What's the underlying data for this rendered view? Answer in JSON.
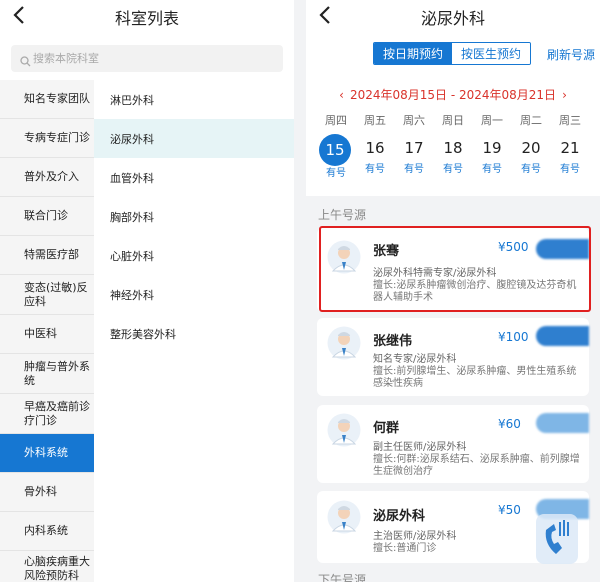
{
  "left": {
    "title": "科室列表",
    "search_placeholder": "搜索本院科室",
    "categories": [
      "知名专家团队",
      "专病专症门诊",
      "普外及介入",
      "联合门诊",
      "特需医疗部",
      "变态(过敏)反应科",
      "中医科",
      "肿瘤与普外系统",
      "早癌及癌前诊疗门诊",
      "外科系统",
      "骨外科",
      "内科系统",
      "心脑疾病重大风险预防科"
    ],
    "active_category_index": 9,
    "subdepartments": [
      "淋巴外科",
      "泌尿外科",
      "血管外科",
      "胸部外科",
      "心脏外科",
      "神经外科",
      "整形美容外科"
    ],
    "active_sub_index": 1
  },
  "right": {
    "title": "泌尿外科",
    "tabs": [
      "按日期预约",
      "按医生预约"
    ],
    "active_tab_index": 0,
    "refresh_label": "刷新号源",
    "date_range": "2024年08月15日 - 2024年08月21日",
    "days": [
      {
        "weekday": "周四",
        "date": "15",
        "status": "有号"
      },
      {
        "weekday": "周五",
        "date": "16",
        "status": "有号"
      },
      {
        "weekday": "周六",
        "date": "17",
        "status": "有号"
      },
      {
        "weekday": "周日",
        "date": "18",
        "status": "有号"
      },
      {
        "weekday": "周一",
        "date": "19",
        "status": "有号"
      },
      {
        "weekday": "周二",
        "date": "20",
        "status": "有号"
      },
      {
        "weekday": "周三",
        "date": "21",
        "status": "有号"
      }
    ],
    "selected_day_index": 0,
    "morning_label": "上午号源",
    "afternoon_label": "下午号源",
    "doctors": [
      {
        "name": "张骞",
        "price": "¥500",
        "title": "泌尿外科特需专家/泌尿外科",
        "skill": "擅长:泌尿系肿瘤微创治疗、腹腔镜及达芬奇机器人辅助手术"
      },
      {
        "name": "张继伟",
        "price": "¥100",
        "title": "知名专家/泌尿外科",
        "skill": "擅长:前列腺增生、泌尿系肿瘤、男性生殖系统感染性疾病"
      },
      {
        "name": "何群",
        "price": "¥60",
        "title": "副主任医师/泌尿外科",
        "skill": "擅长:何群:泌尿系结石、泌尿系肿瘤、前列腺增生症微创治疗"
      },
      {
        "name": "泌尿外科",
        "price": "¥50",
        "title": "主治医师/泌尿外科",
        "skill": "擅长:普通门诊"
      }
    ],
    "colors": {
      "accent": "#1677d2",
      "date_range": "#d9332b",
      "highlight_box": "#e02020"
    }
  }
}
